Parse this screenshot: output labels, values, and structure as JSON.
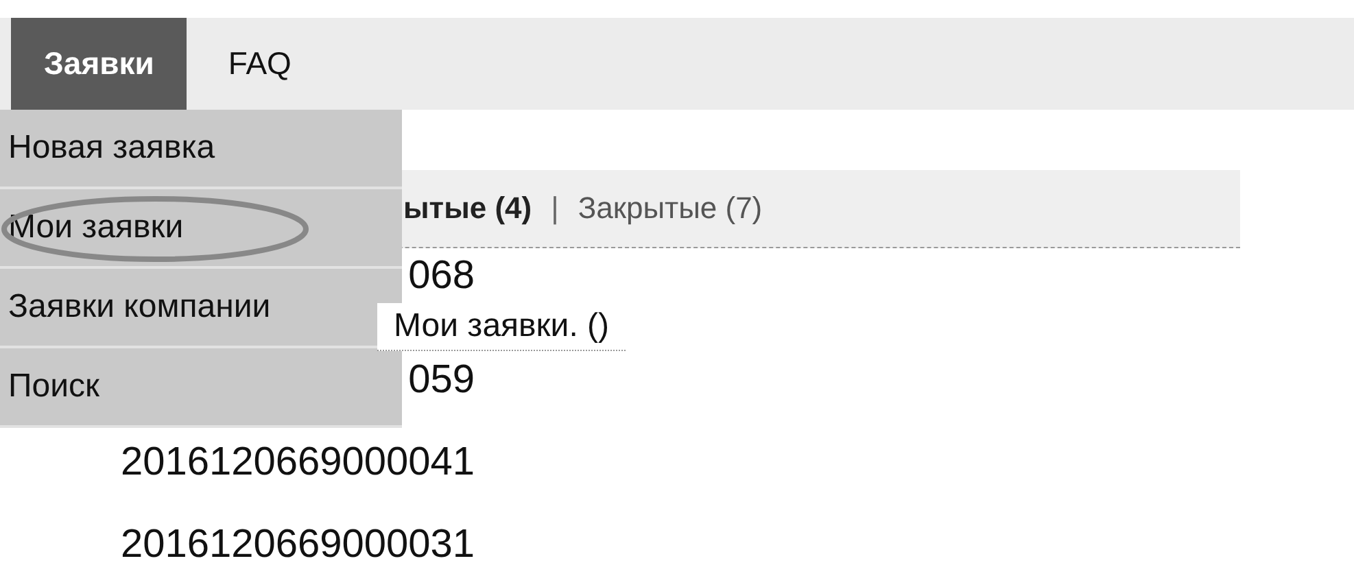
{
  "nav": {
    "tabs": [
      {
        "label": "Заявки",
        "selected": true
      },
      {
        "label": "FAQ",
        "selected": false
      }
    ]
  },
  "menu": {
    "items": [
      {
        "label": "Новая заявка",
        "circled": false
      },
      {
        "label": "Мои заявки",
        "circled": true
      },
      {
        "label": "Заявки компании",
        "circled": false
      },
      {
        "label": "Поиск",
        "circled": false
      }
    ]
  },
  "filters": {
    "separator": "|",
    "items": [
      {
        "label": "ытые (4)",
        "selected": true
      },
      {
        "label": "Закрытые (7)",
        "selected": false
      }
    ]
  },
  "tickets": [
    "068",
    "059",
    "2016120669000041",
    "2016120669000031"
  ],
  "tooltip": {
    "text": "Мои заявки. ()"
  }
}
